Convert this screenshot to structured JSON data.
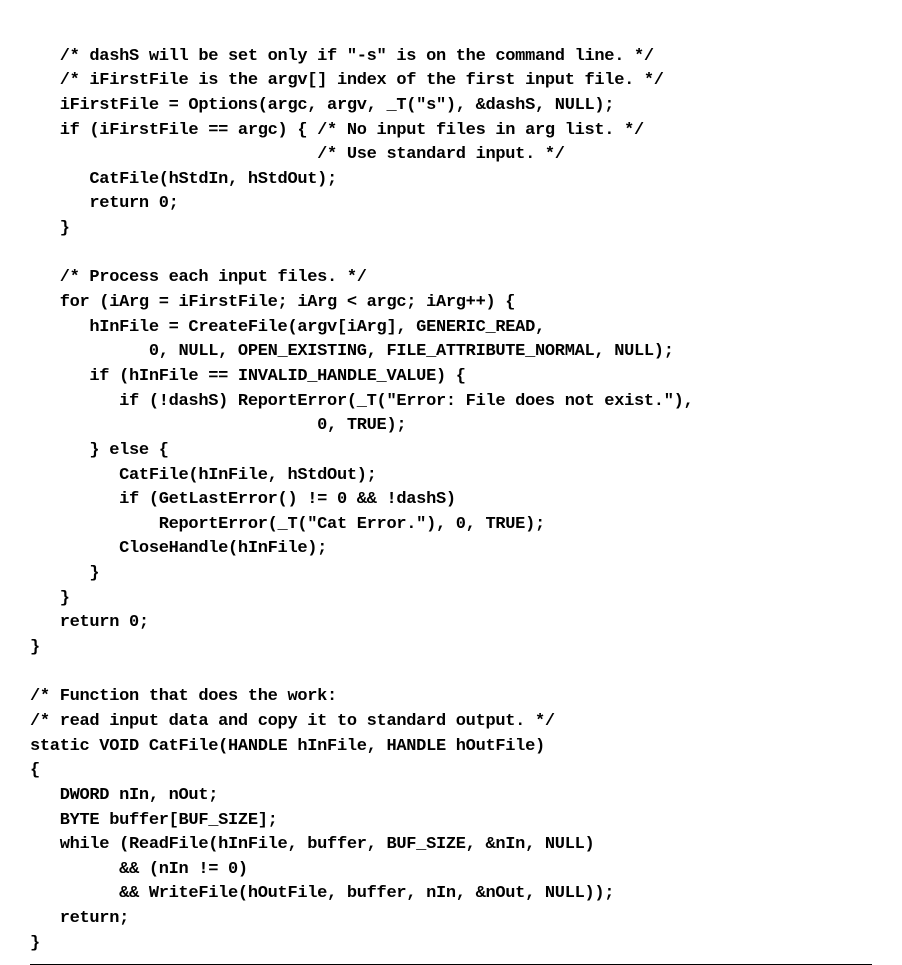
{
  "code": {
    "l01": "   /* dashS will be set only if \"-s\" is on the command line. */",
    "l02": "   /* iFirstFile is the argv[] index of the first input file. */",
    "l03": "   iFirstFile = Options(argc, argv, _T(\"s\"), &dashS, NULL);",
    "l04": "   if (iFirstFile == argc) { /* No input files in arg list. */",
    "l05": "                             /* Use standard input. */",
    "l06": "      CatFile(hStdIn, hStdOut);",
    "l07": "      return 0;",
    "l08": "   }",
    "l09": "",
    "l10": "   /* Process each input files. */",
    "l11": "   for (iArg = iFirstFile; iArg < argc; iArg++) {",
    "l12": "      hInFile = CreateFile(argv[iArg], GENERIC_READ,",
    "l13": "            0, NULL, OPEN_EXISTING, FILE_ATTRIBUTE_NORMAL, NULL);",
    "l14": "      if (hInFile == INVALID_HANDLE_VALUE) {",
    "l15": "         if (!dashS) ReportError(_T(\"Error: File does not exist.\"),",
    "l16": "                             0, TRUE);",
    "l17": "      } else {",
    "l18": "         CatFile(hInFile, hStdOut);",
    "l19": "         if (GetLastError() != 0 && !dashS)",
    "l20": "             ReportError(_T(\"Cat Error.\"), 0, TRUE);",
    "l21": "         CloseHandle(hInFile);",
    "l22": "      }",
    "l23": "   }",
    "l24": "   return 0;",
    "l25": "}",
    "l26": "",
    "l27": "/* Function that does the work:",
    "l28": "/* read input data and copy it to standard output. */",
    "l29": "static VOID CatFile(HANDLE hInFile, HANDLE hOutFile)",
    "l30": "{",
    "l31": "   DWORD nIn, nOut;",
    "l32": "   BYTE buffer[BUF_SIZE];",
    "l33": "   while (ReadFile(hInFile, buffer, BUF_SIZE, &nIn, NULL)",
    "l34": "         && (nIn != 0)",
    "l35": "         && WriteFile(hOutFile, buffer, nIn, &nOut, NULL));",
    "l36": "   return;",
    "l37": "}"
  }
}
